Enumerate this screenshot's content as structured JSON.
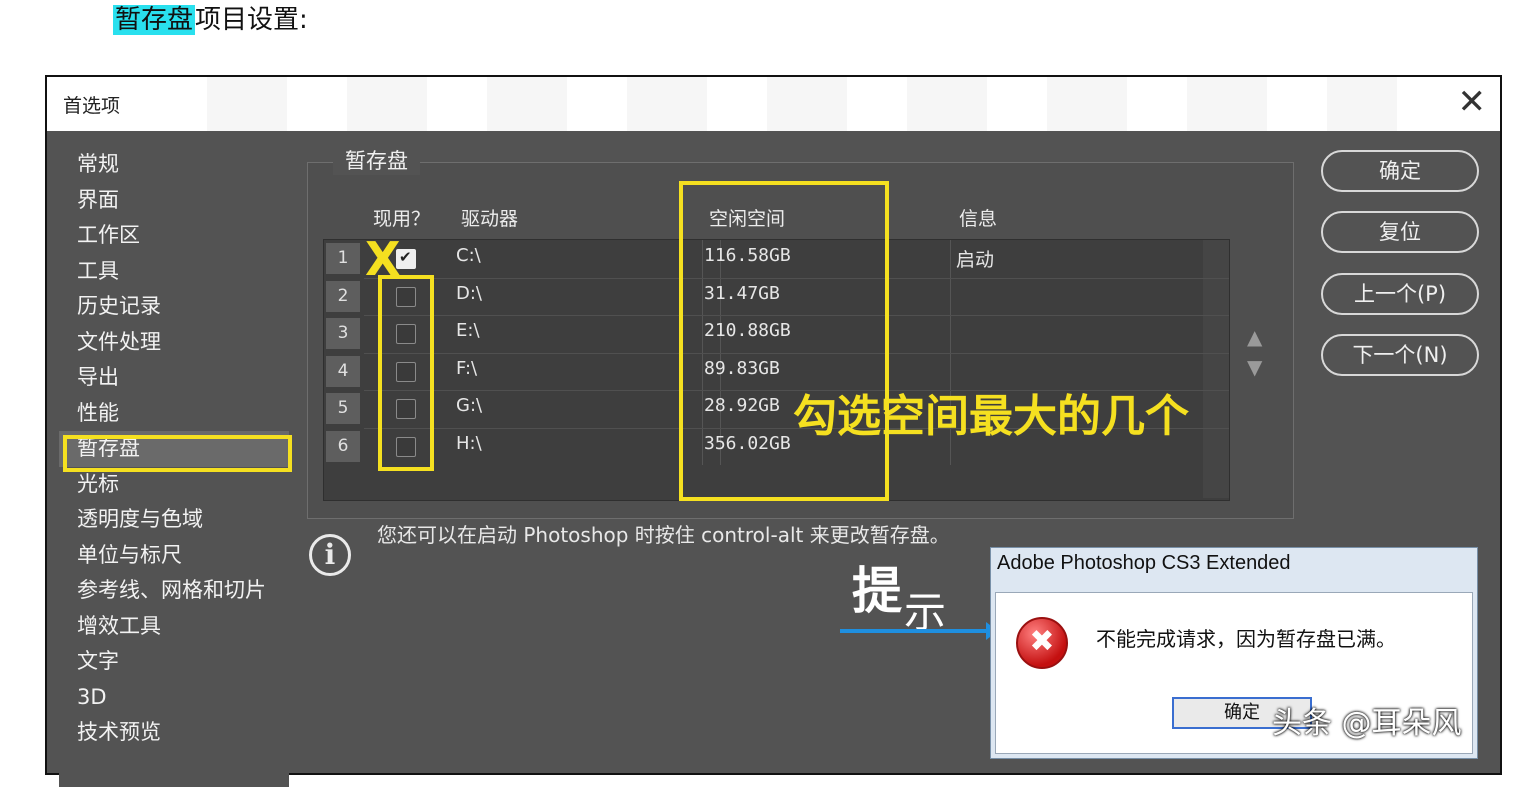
{
  "heading": {
    "highlight": "暂存盘",
    "rest": "项目设置:"
  },
  "dialog": {
    "title": "首选项",
    "close": "✕",
    "sidebar": [
      "常规",
      "界面",
      "工作区",
      "工具",
      "历史记录",
      "文件处理",
      "导出",
      "性能",
      "暂存盘",
      "光标",
      "透明度与色域",
      "单位与标尺",
      "参考线、网格和切片",
      "增效工具",
      "文字",
      "3D",
      "技术预览"
    ],
    "selected_index": 8,
    "group_title": "暂存盘",
    "columns": {
      "active": "现用？",
      "drive": "驱动器",
      "free": "空闲空间",
      "info": "信息"
    },
    "rows": [
      {
        "num": "1",
        "checked": true,
        "drive": "C:\\",
        "free": "116.58GB",
        "info": "启动"
      },
      {
        "num": "2",
        "checked": false,
        "drive": "D:\\",
        "free": "31.47GB",
        "info": ""
      },
      {
        "num": "3",
        "checked": false,
        "drive": "E:\\",
        "free": "210.88GB",
        "info": ""
      },
      {
        "num": "4",
        "checked": false,
        "drive": "F:\\",
        "free": "89.83GB",
        "info": ""
      },
      {
        "num": "5",
        "checked": false,
        "drive": "G:\\",
        "free": "28.92GB",
        "info": ""
      },
      {
        "num": "6",
        "checked": false,
        "drive": "H:\\",
        "free": "356.02GB",
        "info": ""
      }
    ],
    "buttons": {
      "ok": "确定",
      "reset": "复位",
      "prev": "上一个(P)",
      "next": "下一个(N)"
    },
    "hint": "您还可以在启动 Photoshop 时按住 control-alt 来更改暂存盘。",
    "arrow_up": "▲",
    "arrow_down": "▼"
  },
  "annotations": {
    "x_mark": "X",
    "pick_text": "勾选空间最大的几个",
    "tip_a": "提",
    "tip_b": "示"
  },
  "error_dialog": {
    "title": "Adobe Photoshop CS3 Extended",
    "message": "不能完成请求，因为暂存盘已满。",
    "ok": "确定",
    "icon": "✖"
  },
  "watermark": "头条 @耳朵风",
  "colors": {
    "annotation_yellow": "#f5e020",
    "highlight_cyan": "#29e0ee",
    "arrow_blue": "#1e8fe0"
  }
}
